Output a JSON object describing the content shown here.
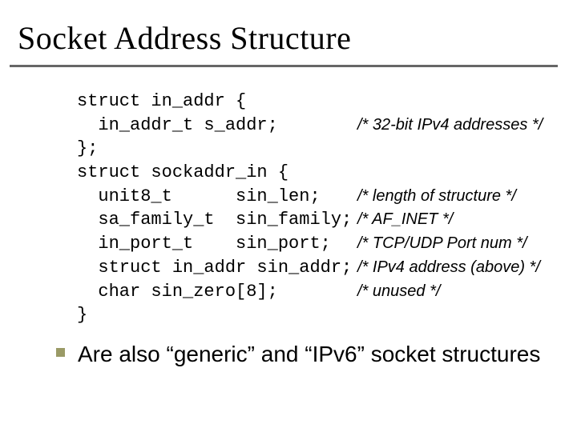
{
  "title": "Socket Address Structure",
  "code": {
    "l1": "struct in_addr {",
    "l2a": "  in_addr_t s_addr;",
    "l2b": "/* 32-bit IPv4 addresses */",
    "l3": "};",
    "l4": "struct sockaddr_in {",
    "l5a": "  unit8_t      sin_len;",
    "l5b": "/* length of structure */",
    "l6a": "  sa_family_t  sin_family;",
    "l6b": "/* AF_INET */",
    "l7a": "  in_port_t    sin_port;",
    "l7b": "/* TCP/UDP Port num */",
    "l8a": "  struct in_addr sin_addr;",
    "l8b": "/* IPv4 address (above) */",
    "l9a": "  char sin_zero[8];",
    "l9b": "/* unused */",
    "l10": "}"
  },
  "bullet": "Are also “generic” and  “IPv6” socket structures"
}
